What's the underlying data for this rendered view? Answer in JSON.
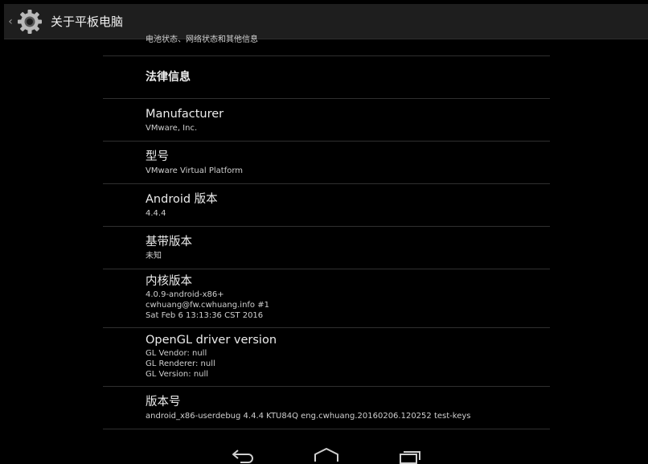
{
  "actionbar": {
    "title": "关于平板电脑",
    "icon": "settings-gear-icon"
  },
  "items": [
    {
      "id": "status",
      "summary": "电池状态、网络状态和其他信息"
    },
    {
      "id": "legal",
      "title": "法律信息"
    },
    {
      "id": "manufacturer",
      "title": "Manufacturer",
      "summary": [
        "VMware, Inc."
      ]
    },
    {
      "id": "model",
      "title": "型号",
      "summary": [
        "VMware Virtual Platform"
      ]
    },
    {
      "id": "android-version",
      "title": "Android 版本",
      "summary": [
        "4.4.4"
      ]
    },
    {
      "id": "baseband",
      "title": "基带版本",
      "summary": [
        "未知"
      ]
    },
    {
      "id": "kernel",
      "title": "内核版本",
      "summary": [
        "4.0.9-android-x86+",
        "cwhuang@fw.cwhuang.info #1",
        "Sat Feb 6 13:13:36 CST 2016"
      ]
    },
    {
      "id": "opengl",
      "title": "OpenGL driver version",
      "summary": [
        "GL Vendor: null",
        "GL Renderer: null",
        "GL Version: null"
      ]
    },
    {
      "id": "build",
      "title": "版本号",
      "summary": [
        "android_x86-userdebug 4.4.4 KTU84Q eng.cwhuang.20160206.120252 test-keys"
      ]
    }
  ],
  "navbar": {
    "icons": [
      "back-icon",
      "home-icon",
      "recents-icon"
    ]
  },
  "colors": {
    "background": "#000000",
    "actionbar": "#1e1e1e",
    "divider": "#2f2f2f"
  }
}
